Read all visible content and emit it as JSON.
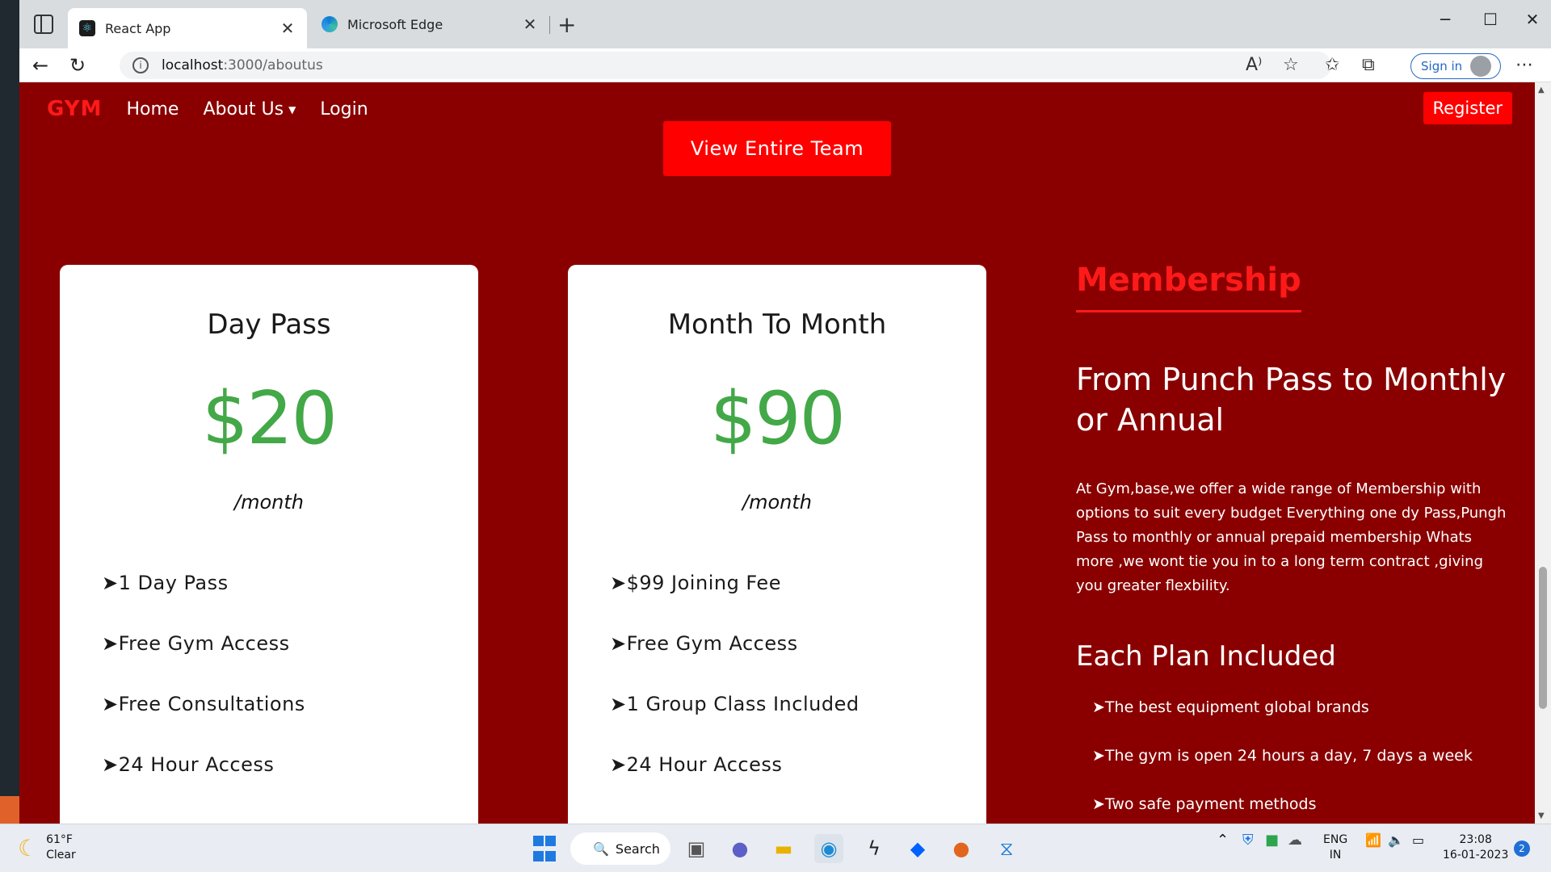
{
  "browser": {
    "tabs": [
      {
        "label": "React App",
        "favicon": "react-icon"
      },
      {
        "label": "Microsoft Edge",
        "favicon": "edge-icon"
      }
    ],
    "url_host": "localhost",
    "url_path": ":3000/aboutus",
    "signin_label": "Sign in"
  },
  "navbar": {
    "brand": "GYM",
    "links": [
      "Home",
      "About Us",
      "Login"
    ],
    "register_label": "Register"
  },
  "team_button_label": "View Entire Team",
  "plans": [
    {
      "title": "Day Pass",
      "price": "$20",
      "period": "/month",
      "features": [
        "➤1 Day Pass",
        "➤Free Gym Access",
        "➤Free Consultations",
        "➤24 Hour Access"
      ]
    },
    {
      "title": "Month To Month",
      "price": "$90",
      "period": "/month",
      "features": [
        "➤$99 Joining Fee",
        "➤Free Gym Access",
        "➤1 Group Class Included",
        "➤24 Hour Access"
      ]
    }
  ],
  "membership": {
    "heading": "Membership",
    "subheading": "From Punch Pass to Monthly or Annual",
    "description": "At Gym,base,we offer a wide range of Membership with options to suit every budget Everything one dy Pass,Pungh Pass to monthly or annual prepaid membership Whats more ,we wont tie you in to a long term contract ,giving you greater flexbility.",
    "plan_heading": "Each Plan Included",
    "items": [
      "➤The best equipment global brands",
      "➤The gym is open 24 hours a day, 7 days a week",
      "➤Two safe payment methods"
    ]
  },
  "taskbar": {
    "weather_temp": "61°F",
    "weather_desc": "Clear",
    "search_label": "Search",
    "lang_line1": "ENG",
    "lang_line2": "IN",
    "time": "23:08",
    "date": "16-01-2023",
    "notification_count": "2"
  },
  "colors": {
    "page_bg": "#8a0000",
    "accent_red": "#ff0000",
    "price_green": "#43a847"
  }
}
